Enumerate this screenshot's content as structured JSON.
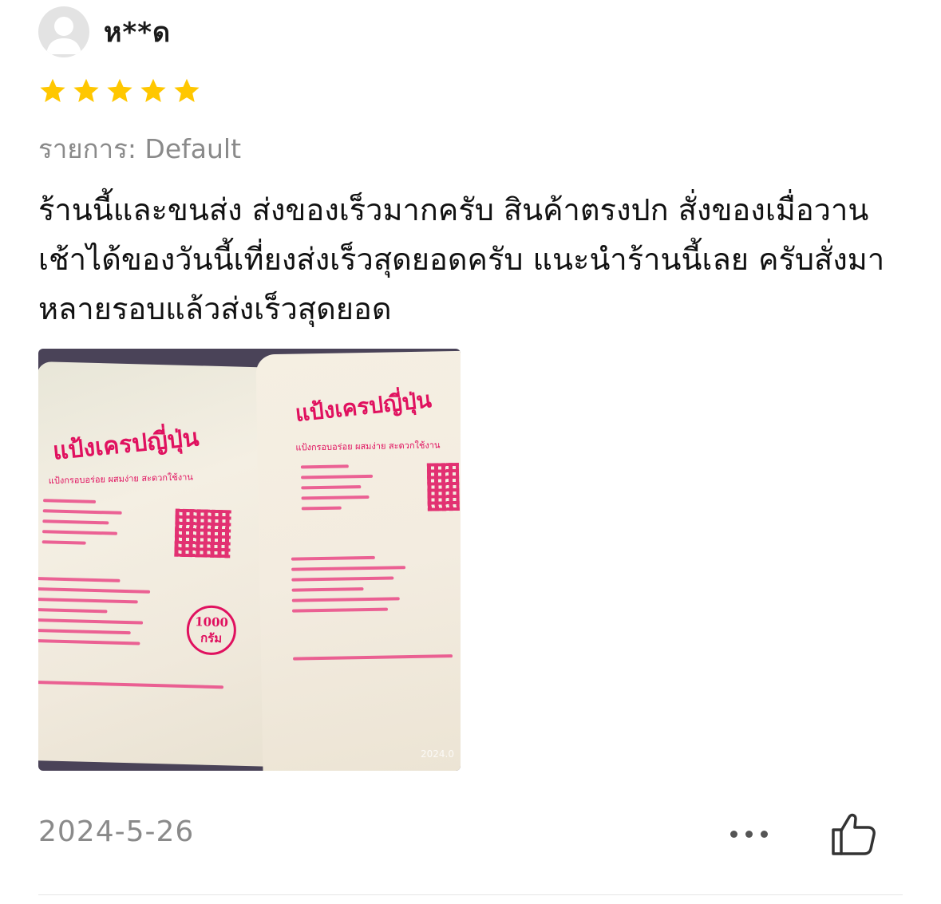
{
  "review": {
    "username": "ห**ด",
    "rating": 5,
    "rating_max": 5,
    "star_color": "#FFC700",
    "variant_text": "รายการ: Default",
    "text": "ร้านนี้และขนส่ง ส่งของเร็วมากครับ สินค้าตรงปก สั่งของเมื่อวานเช้าได้ของวันนี้เที่ยงส่งเร็วสุดยอดครับ แนะนำร้านนี้เลย ครับสั่งมาหลายรอบแล้วส่งเร็วสุดยอด",
    "date": "2024-5-26",
    "photo": {
      "product_title": "แป้งเครปญี่ปุ่น",
      "product_subtitle": "แป้งกรอบอร่อย ผสมง่าย สะดวกใช้งาน",
      "weight_label": "1000 กรัม",
      "stamp": "2024.0"
    }
  },
  "icons": {
    "avatar": "default-user-avatar",
    "star": "star-icon",
    "more": "more-horizontal-icon",
    "like": "thumbs-up-icon"
  }
}
